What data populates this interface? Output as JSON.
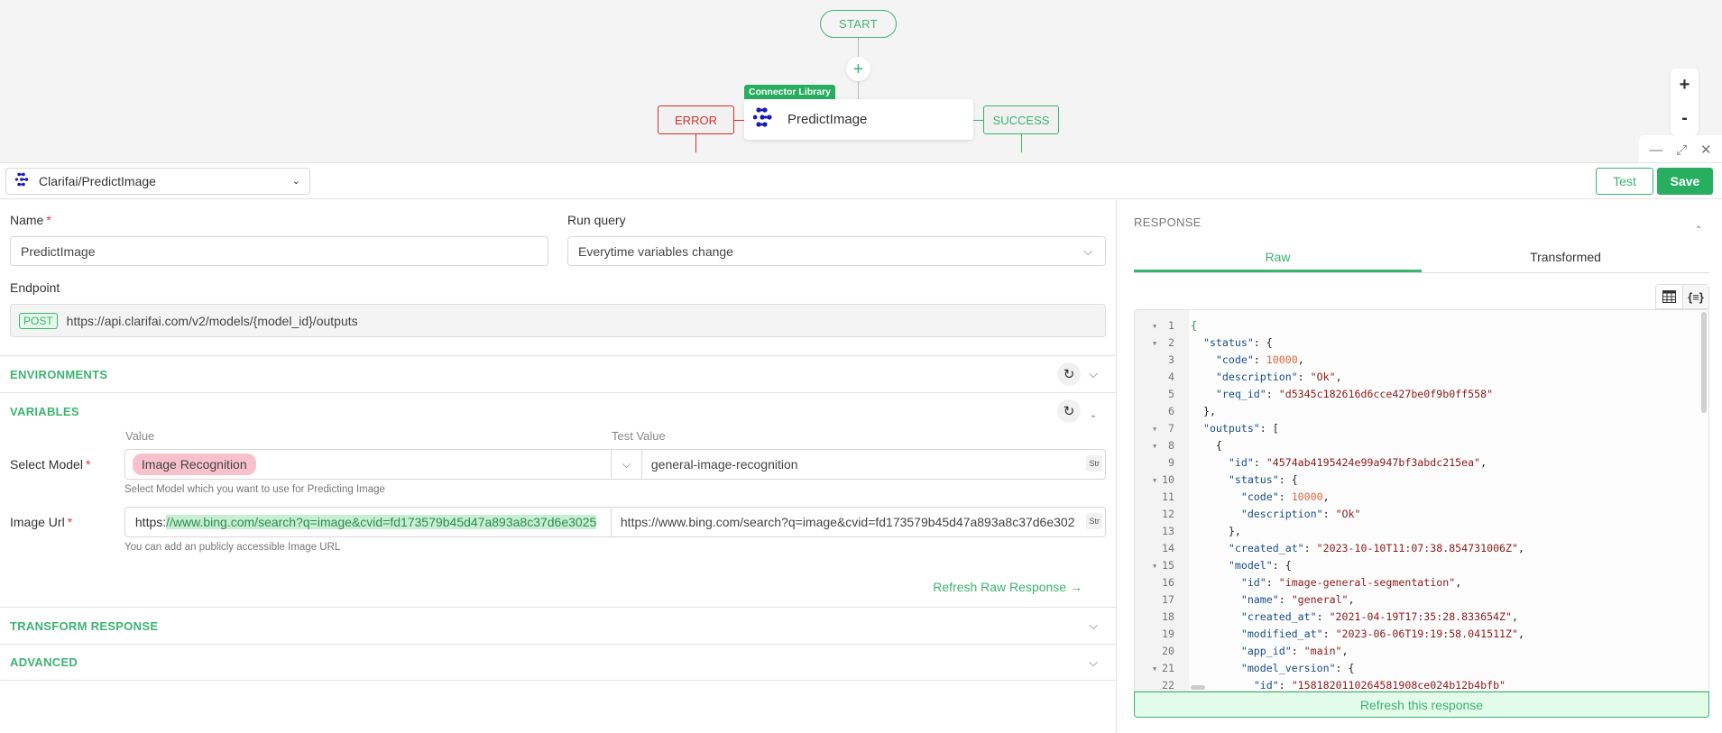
{
  "canvas": {
    "start_label": "START",
    "add_label": "+",
    "node_tag": "Connector Library",
    "node_label": "PredictImage",
    "error_label": "ERROR",
    "success_label": "SUCCESS",
    "zoom_in": "+",
    "zoom_out": "-"
  },
  "window_controls": {
    "minimize": "—",
    "expand": "⤢",
    "close": "✕"
  },
  "header": {
    "datasource": "Clarifai/PredictImage",
    "test_label": "Test",
    "save_label": "Save"
  },
  "form": {
    "name_label": "Name",
    "name_value": "PredictImage",
    "run_query_label": "Run query",
    "run_query_value": "Everytime variables change",
    "endpoint_label": "Endpoint",
    "endpoint_method": "POST",
    "endpoint_url": "https://api.clarifai.com/v2/models/{model_id}/outputs"
  },
  "sections": {
    "environments": "ENVIRONMENTS",
    "variables": "VARIABLES",
    "transform": "TRANSFORM RESPONSE",
    "advanced": "ADVANCED"
  },
  "variables": {
    "value_header": "Value",
    "test_value_header": "Test Value",
    "rows": [
      {
        "label": "Select Model",
        "value": "Image Recognition",
        "test_value": "general-image-recognition",
        "type": "Str",
        "hint": "Select Model which you want to use for Predicting Image"
      },
      {
        "label": "Image Url",
        "value_prefix": "https:",
        "value_highlight": "//www.bing.com/search?q=image&cvid=fd173579b45d47a893a8c37d6e3025",
        "test_value": "https://www.bing.com/search?q=image&cvid=fd173579b45d47a893a8c37d6e302",
        "type": "Str",
        "hint": "You can add an publicly accessible Image URL"
      }
    ],
    "refresh_raw": "Refresh Raw Response →"
  },
  "response": {
    "title": "RESPONSE",
    "tabs": [
      "Raw",
      "Transformed"
    ],
    "refresh_label": "Refresh this response",
    "code_lines": [
      {
        "n": "1",
        "fold": true,
        "indent": 0,
        "parts": [
          [
            "br",
            "{"
          ]
        ]
      },
      {
        "n": "2",
        "fold": true,
        "indent": 1,
        "parts": [
          [
            "k",
            "\"status\""
          ],
          [
            "p",
            ": {"
          ]
        ]
      },
      {
        "n": "3",
        "fold": false,
        "indent": 2,
        "parts": [
          [
            "k",
            "\"code\""
          ],
          [
            "p",
            ": "
          ],
          [
            "n",
            "10000"
          ],
          [
            "p",
            ","
          ]
        ]
      },
      {
        "n": "4",
        "fold": false,
        "indent": 2,
        "parts": [
          [
            "k",
            "\"description\""
          ],
          [
            "p",
            ": "
          ],
          [
            "s",
            "\"Ok\""
          ],
          [
            "p",
            ","
          ]
        ]
      },
      {
        "n": "5",
        "fold": false,
        "indent": 2,
        "parts": [
          [
            "k",
            "\"req_id\""
          ],
          [
            "p",
            ": "
          ],
          [
            "s",
            "\"d5345c182616d6cce427be0f9b0ff558\""
          ]
        ]
      },
      {
        "n": "6",
        "fold": false,
        "indent": 1,
        "parts": [
          [
            "p",
            "},"
          ]
        ]
      },
      {
        "n": "7",
        "fold": true,
        "indent": 1,
        "parts": [
          [
            "k",
            "\"outputs\""
          ],
          [
            "p",
            ": ["
          ]
        ]
      },
      {
        "n": "8",
        "fold": true,
        "indent": 2,
        "parts": [
          [
            "p",
            "{"
          ]
        ]
      },
      {
        "n": "9",
        "fold": false,
        "indent": 3,
        "parts": [
          [
            "k",
            "\"id\""
          ],
          [
            "p",
            ": "
          ],
          [
            "s",
            "\"4574ab4195424e99a947bf3abdc215ea\""
          ],
          [
            "p",
            ","
          ]
        ]
      },
      {
        "n": "10",
        "fold": true,
        "indent": 3,
        "parts": [
          [
            "k",
            "\"status\""
          ],
          [
            "p",
            ": {"
          ]
        ]
      },
      {
        "n": "11",
        "fold": false,
        "indent": 4,
        "parts": [
          [
            "k",
            "\"code\""
          ],
          [
            "p",
            ": "
          ],
          [
            "n",
            "10000"
          ],
          [
            "p",
            ","
          ]
        ]
      },
      {
        "n": "12",
        "fold": false,
        "indent": 4,
        "parts": [
          [
            "k",
            "\"description\""
          ],
          [
            "p",
            ": "
          ],
          [
            "s",
            "\"Ok\""
          ]
        ]
      },
      {
        "n": "13",
        "fold": false,
        "indent": 3,
        "parts": [
          [
            "p",
            "},"
          ]
        ]
      },
      {
        "n": "14",
        "fold": false,
        "indent": 3,
        "parts": [
          [
            "k",
            "\"created_at\""
          ],
          [
            "p",
            ": "
          ],
          [
            "s",
            "\"2023-10-10T11:07:38.854731006Z\""
          ],
          [
            "p",
            ","
          ]
        ]
      },
      {
        "n": "15",
        "fold": true,
        "indent": 3,
        "parts": [
          [
            "k",
            "\"model\""
          ],
          [
            "p",
            ": {"
          ]
        ]
      },
      {
        "n": "16",
        "fold": false,
        "indent": 4,
        "parts": [
          [
            "k",
            "\"id\""
          ],
          [
            "p",
            ": "
          ],
          [
            "s",
            "\"image-general-segmentation\""
          ],
          [
            "p",
            ","
          ]
        ]
      },
      {
        "n": "17",
        "fold": false,
        "indent": 4,
        "parts": [
          [
            "k",
            "\"name\""
          ],
          [
            "p",
            ": "
          ],
          [
            "s",
            "\"general\""
          ],
          [
            "p",
            ","
          ]
        ]
      },
      {
        "n": "18",
        "fold": false,
        "indent": 4,
        "parts": [
          [
            "k",
            "\"created_at\""
          ],
          [
            "p",
            ": "
          ],
          [
            "s",
            "\"2021-04-19T17:35:28.833654Z\""
          ],
          [
            "p",
            ","
          ]
        ]
      },
      {
        "n": "19",
        "fold": false,
        "indent": 4,
        "parts": [
          [
            "k",
            "\"modified_at\""
          ],
          [
            "p",
            ": "
          ],
          [
            "s",
            "\"2023-06-06T19:19:58.041511Z\""
          ],
          [
            "p",
            ","
          ]
        ]
      },
      {
        "n": "20",
        "fold": false,
        "indent": 4,
        "parts": [
          [
            "k",
            "\"app_id\""
          ],
          [
            "p",
            ": "
          ],
          [
            "s",
            "\"main\""
          ],
          [
            "p",
            ","
          ]
        ]
      },
      {
        "n": "21",
        "fold": true,
        "indent": 4,
        "parts": [
          [
            "k",
            "\"model_version\""
          ],
          [
            "p",
            ": {"
          ]
        ]
      },
      {
        "n": "22",
        "fold": false,
        "indent": 5,
        "parts": [
          [
            "k",
            "\"id\""
          ],
          [
            "p",
            ": "
          ],
          [
            "s",
            "\"1581820110264581908ce024b12b4bfb\""
          ]
        ]
      }
    ]
  },
  "colors": {
    "accent": "#3cb371",
    "save_bg": "#27ae60",
    "error": "#d32f2f",
    "tag_pink": "#f8c1cb"
  }
}
